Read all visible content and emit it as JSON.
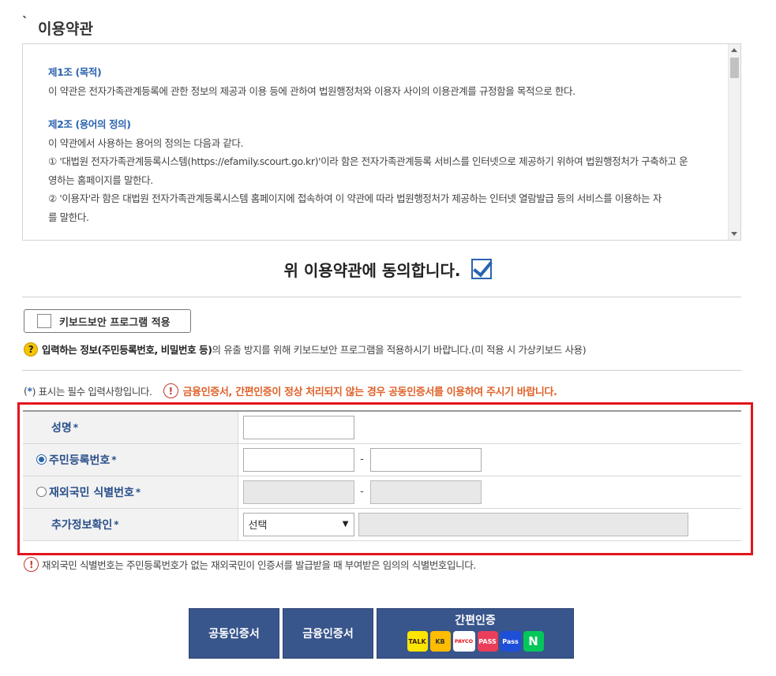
{
  "terms": {
    "section_title": "이용약관",
    "article1_title": "제1조 (목적)",
    "article1_body": "이 약관은 전자가족관계등록에 관한 정보의 제공과 이용 등에 관하여 법원행정처와 이용자 사이의 이용관계를 규정함을 목적으로 한다.",
    "article2_title": "제2조 (용어의 정의)",
    "article2_intro": "이 약관에서 사용하는 용어의 정의는 다음과 같다.",
    "article2_item1_a": "① '대법원 전자가족관계등록시스템(https://efamily.scourt.go.kr)'이라 함은 전자가족관계등록 서비스를 인터넷으로 제공하기 위하여 법원행정처가 구축하고 운",
    "article2_item1_b": "영하는 홈페이지를 말한다.",
    "article2_item2_a": "② '이용자'라 함은 대법원 전자가족관계등록시스템 홈페이지에 접속하여 이 약관에 따라 법원행정처가 제공하는 인터넷 열람발급 등의 서비스를 이용하는 자",
    "article2_item2_b": "를 말한다."
  },
  "agree": {
    "text": "위 이용약관에 동의합니다.",
    "checked": true
  },
  "keyboard_security": {
    "button_label": "키보드보안 프로그램 적용",
    "notice_bold": "입력하는 정보(주민등록번호, 비밀번호 등)",
    "notice_rest": "의 유출 방지를 위해 키보드보안 프로그램을 적용하시기 바랍니다.(미 적용 시 가상키보드 사용)"
  },
  "required_note": {
    "prefix": "(",
    "star": "*",
    "suffix": ") 표시는 필수 입력사항입니다.",
    "warning": "금융인증서, 간편인증이 정상 처리되지 않는 경우 공동인증서를 이용하여 주시기 바랍니다."
  },
  "form": {
    "name_label": "성명",
    "resident_label": "주민등록번호",
    "foreigner_label": "재외국민 식별번호",
    "extra_label": "추가정보확인",
    "required_mark": "*",
    "dash": "-",
    "extra_select_value": "선택",
    "selected_id_type": "주민등록번호"
  },
  "foreign_note": "재외국민 식별번호는 주민등록번호가 없는 재외국민이 인증서를 발급받을 때 부여받은 임의의 식별번호입니다.",
  "buttons": {
    "joint_cert": "공동인증서",
    "financial_cert": "금융인증서",
    "simple_auth": "간편인증",
    "providers": [
      "TALK",
      "KB",
      "PAYCO",
      "PASS",
      "Pass",
      "N"
    ]
  },
  "colors": {
    "accent_blue": "#2a63b0",
    "highlight_red": "#e3141b",
    "warning_orange": "#e0622a",
    "button_navy": "#38558c"
  }
}
